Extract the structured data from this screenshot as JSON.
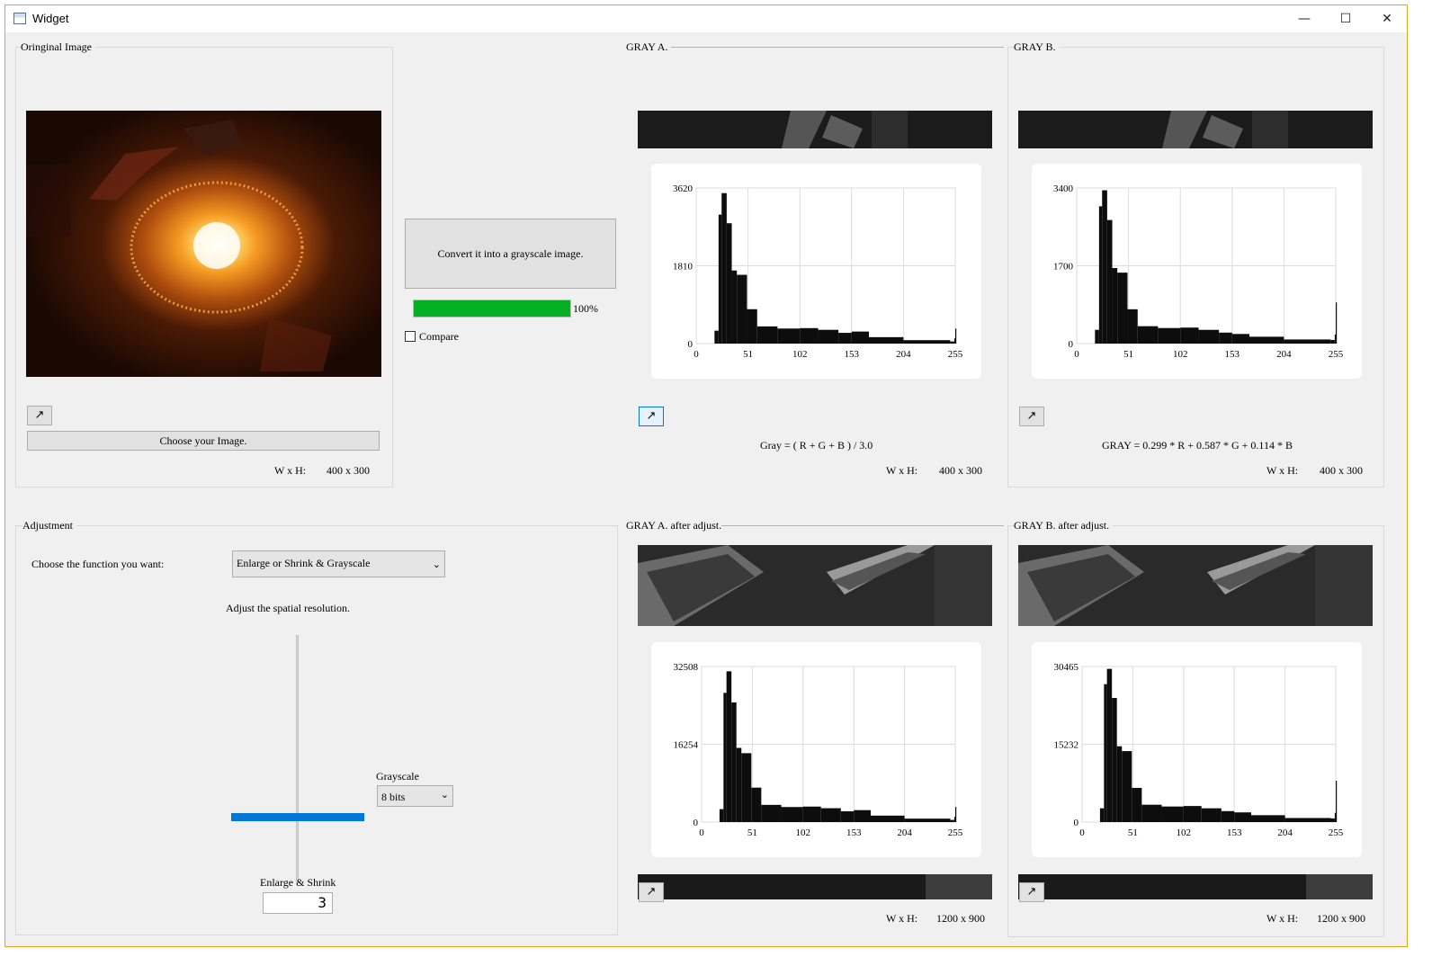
{
  "window": {
    "title": "Widget",
    "minimize": "—",
    "maximize": "☐",
    "close": "✕"
  },
  "original": {
    "label": "Oringinal Image",
    "expand_icon": "↗",
    "choose_button": "Choose your Image.",
    "wxh_label": "W x H:",
    "wxh_value": "400 x 300"
  },
  "convert": {
    "button": "Convert it into a grayscale image.",
    "progress": 100,
    "progress_text": "100%",
    "compare_label": "Compare"
  },
  "gray_a": {
    "label": "GRAY A.",
    "formula": "Gray = ( R + G + B ) / 3.0",
    "wxh_label": "W x H:",
    "wxh_value": "400 x 300",
    "ticks_y": [
      "3620",
      "1810",
      "0"
    ],
    "ticks_x": [
      "0",
      "51",
      "102",
      "153",
      "204",
      "255"
    ]
  },
  "gray_b": {
    "label": "GRAY B.",
    "formula": "GRAY = 0.299 * R + 0.587 * G + 0.114 * B",
    "wxh_label": "W x H:",
    "wxh_value": "400 x 300",
    "ticks_y": [
      "3400",
      "1700",
      "0"
    ],
    "ticks_x": [
      "0",
      "51",
      "102",
      "153",
      "204",
      "255"
    ]
  },
  "gray_a_adj": {
    "label": "GRAY A. after adjust.",
    "wxh_label": "W x H:",
    "wxh_value": "1200 x 900",
    "ticks_y": [
      "32508",
      "16254",
      "0"
    ],
    "ticks_x": [
      "0",
      "51",
      "102",
      "153",
      "204",
      "255"
    ]
  },
  "gray_b_adj": {
    "label": "GRAY B. after adjust.",
    "wxh_label": "W x H:",
    "wxh_value": "1200 x 900",
    "ticks_y": [
      "30465",
      "15232",
      "0"
    ],
    "ticks_x": [
      "0",
      "51",
      "102",
      "153",
      "204",
      "255"
    ]
  },
  "adjustment": {
    "label": "Adjustment",
    "choose_label": "Choose the function you want:",
    "function_value": "Enlarge or Shrink & Grayscale",
    "spatial_label": "Adjust the spatial resolution.",
    "grayscale_label": "Grayscale",
    "grayscale_value": "8 bits",
    "enlarge_label": "Enlarge & Shrink",
    "enlarge_value": "3"
  },
  "colors": {
    "accent": "#0078d7",
    "progress": "#06b025",
    "window_bg": "#f0f0f0"
  },
  "chart_data": [
    {
      "type": "bar",
      "title": "",
      "xlim": [
        0,
        255
      ],
      "ylim": [
        0,
        3620
      ],
      "x": [
        0,
        10,
        18,
        22,
        25,
        30,
        35,
        40,
        50,
        60,
        80,
        102,
        120,
        140,
        153,
        170,
        204,
        250,
        254,
        255
      ],
      "values": [
        0,
        0,
        300,
        3000,
        3500,
        2800,
        1700,
        1600,
        800,
        400,
        350,
        360,
        320,
        250,
        280,
        150,
        80,
        50,
        120,
        350
      ]
    },
    {
      "type": "bar",
      "title": "",
      "xlim": [
        0,
        255
      ],
      "ylim": [
        0,
        3400
      ],
      "x": [
        0,
        10,
        18,
        22,
        25,
        30,
        35,
        40,
        50,
        60,
        80,
        102,
        120,
        140,
        153,
        170,
        204,
        250,
        254,
        255
      ],
      "values": [
        0,
        0,
        300,
        3000,
        3350,
        2700,
        1650,
        1550,
        750,
        380,
        340,
        350,
        300,
        240,
        210,
        150,
        90,
        80,
        200,
        900
      ]
    },
    {
      "type": "bar",
      "title": "",
      "xlim": [
        0,
        255
      ],
      "ylim": [
        0,
        32508
      ],
      "x": [
        0,
        10,
        18,
        22,
        25,
        30,
        35,
        40,
        50,
        60,
        80,
        102,
        120,
        140,
        153,
        170,
        204,
        250,
        254,
        255
      ],
      "values": [
        0,
        0,
        2700,
        27000,
        31500,
        25000,
        15500,
        14400,
        7200,
        3600,
        3150,
        3240,
        2900,
        2250,
        2500,
        1350,
        720,
        450,
        1080,
        3150
      ]
    },
    {
      "type": "bar",
      "title": "",
      "xlim": [
        0,
        255
      ],
      "ylim": [
        0,
        30465
      ],
      "x": [
        0,
        10,
        18,
        22,
        25,
        30,
        35,
        40,
        50,
        60,
        80,
        102,
        120,
        140,
        153,
        170,
        204,
        250,
        254,
        255
      ],
      "values": [
        0,
        0,
        2700,
        27000,
        30000,
        24300,
        14850,
        13900,
        6700,
        3400,
        3050,
        3150,
        2700,
        2150,
        1900,
        1350,
        800,
        720,
        1800,
        8100
      ]
    }
  ]
}
